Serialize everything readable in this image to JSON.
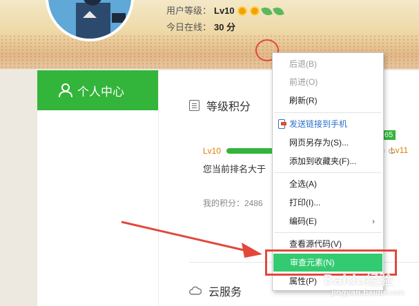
{
  "user": {
    "level_label": "用户等级：",
    "level_value": "Lv10",
    "online_label": "今日在线：",
    "online_value": "30 分"
  },
  "sidebar": {
    "active_item": "个人中心"
  },
  "main": {
    "section_title": "等级积分",
    "level_current": "Lv10",
    "level_next": "Lv11",
    "points_badge": "65",
    "progress": 0.95,
    "rank_text": "您当前排名大于",
    "score_text": "我的积分：2486",
    "cloud_title": "云服务"
  },
  "context_menu": {
    "items": [
      {
        "label": "后退(B)",
        "state": "disabled"
      },
      {
        "label": "前进(O)",
        "state": "disabled"
      },
      {
        "label": "刷新(R)",
        "state": "normal"
      },
      {
        "label": "发送链接到手机",
        "state": "link"
      },
      {
        "label": "网页另存为(S)...",
        "state": "normal"
      },
      {
        "label": "添加到收藏夹(F)...",
        "state": "normal"
      },
      {
        "label": "全选(A)",
        "state": "normal"
      },
      {
        "label": "打印(I)...",
        "state": "normal"
      },
      {
        "label": "编码(E)",
        "state": "normal"
      },
      {
        "label": "查看源代码(V)",
        "state": "normal"
      },
      {
        "label": "审查元素(N)",
        "state": "highlighted"
      },
      {
        "label": "属性(P)",
        "state": "normal"
      }
    ]
  },
  "watermark": {
    "brand": "Baidu经验",
    "url": "jingyan.baidu.com"
  },
  "colors": {
    "accent_green": "#33b43a",
    "highlight_green": "#33cb72",
    "annotation_red": "#e2473c",
    "level_orange": "#e07b00"
  }
}
